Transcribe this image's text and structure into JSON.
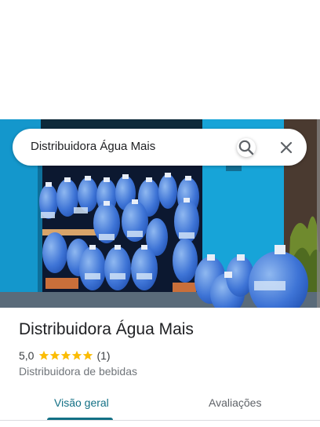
{
  "search": {
    "query": "Distribuidora Água Mais"
  },
  "photo": {
    "alt": "place-photo"
  },
  "place": {
    "name": "Distribuidora Água Mais",
    "rating": "5,0",
    "rating_value": 5.0,
    "reviews_count": "(1)",
    "category": "Distribuidora de bebidas",
    "star_color": "#fbbc04"
  },
  "tabs": [
    {
      "label": "Visão geral",
      "active": true
    },
    {
      "label": "Avaliações",
      "active": false
    }
  ],
  "colors": {
    "accent": "#137085"
  }
}
